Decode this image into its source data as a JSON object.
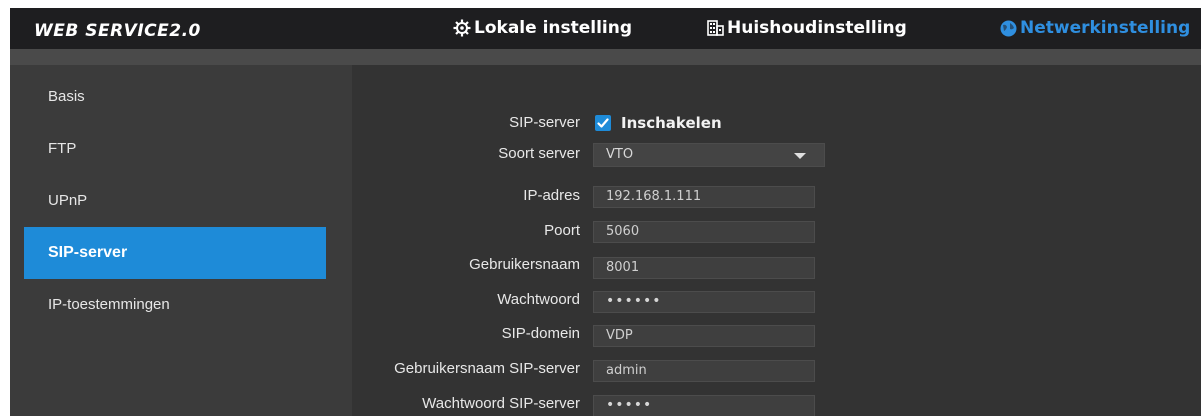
{
  "header": {
    "logo": "WEB SERVICE2.0",
    "tabs": [
      {
        "label": "Lokale instelling",
        "icon": "gear-icon"
      },
      {
        "label": "Huishoudinstelling",
        "icon": "building-icon"
      },
      {
        "label": "Netwerkinstelling",
        "icon": "globe-icon",
        "active": true
      }
    ]
  },
  "sidebar": {
    "items": [
      {
        "label": "Basis"
      },
      {
        "label": "FTP"
      },
      {
        "label": "UPnP"
      },
      {
        "label": "SIP-server",
        "active": true
      },
      {
        "label": "IP-toestemmingen"
      }
    ]
  },
  "form": {
    "sip_server": {
      "label": "SIP-server",
      "checkbox_label": "Inschakelen",
      "checked": true
    },
    "server_type": {
      "label": "Soort server",
      "value": "VTO"
    },
    "ip_address": {
      "label": "IP-adres",
      "value": "192.168.1.111"
    },
    "port": {
      "label": "Poort",
      "value": "5060"
    },
    "username": {
      "label": "Gebruikersnaam",
      "value": "8001"
    },
    "password": {
      "label": "Wachtwoord",
      "value": "••••••"
    },
    "sip_domain": {
      "label": "SIP-domein",
      "value": "VDP"
    },
    "sip_username": {
      "label": "Gebruikersnaam SIP-server",
      "value": "admin"
    },
    "sip_password": {
      "label": "Wachtwoord SIP-server",
      "value": "•••••"
    }
  },
  "colors": {
    "accent": "#1e8bd8",
    "active_tab": "#2f8fe0",
    "topbar": "#1e1e20",
    "sidebar_bg": "#3b3b3b",
    "content_bg": "#333333"
  }
}
